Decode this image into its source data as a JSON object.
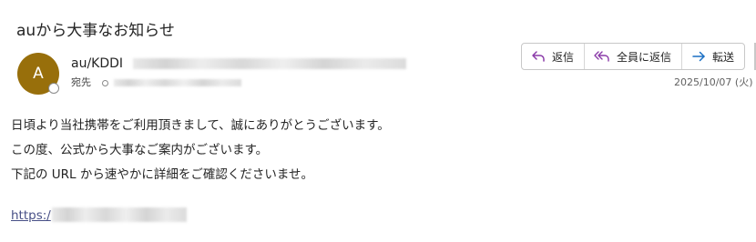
{
  "email": {
    "subject": "auから大事なお知らせ",
    "avatar_initial": "A",
    "sender_name": "au/KDDI",
    "to_label": "宛先",
    "date": "2025/10/07 (火)"
  },
  "actions": {
    "reply": "返信",
    "reply_all": "全員に返信",
    "forward": "転送"
  },
  "body": {
    "lines": [
      "日頃より当社携帯をご利用頂きまして、誠にありがとうございます。",
      "この度、公式から大事なご案内がございます。",
      "下記の URL から速やかに詳細をご確認くださいませ。"
    ],
    "link_prefix": "https:/"
  },
  "colors": {
    "avatar": "#986f0b",
    "reply_icon": "#8a3aa8",
    "forward_icon": "#1a6fc4",
    "link": "#474f86"
  },
  "icons": {
    "reply": "reply-arrow-icon",
    "reply_all": "reply-all-arrow-icon",
    "forward": "forward-arrow-icon"
  }
}
